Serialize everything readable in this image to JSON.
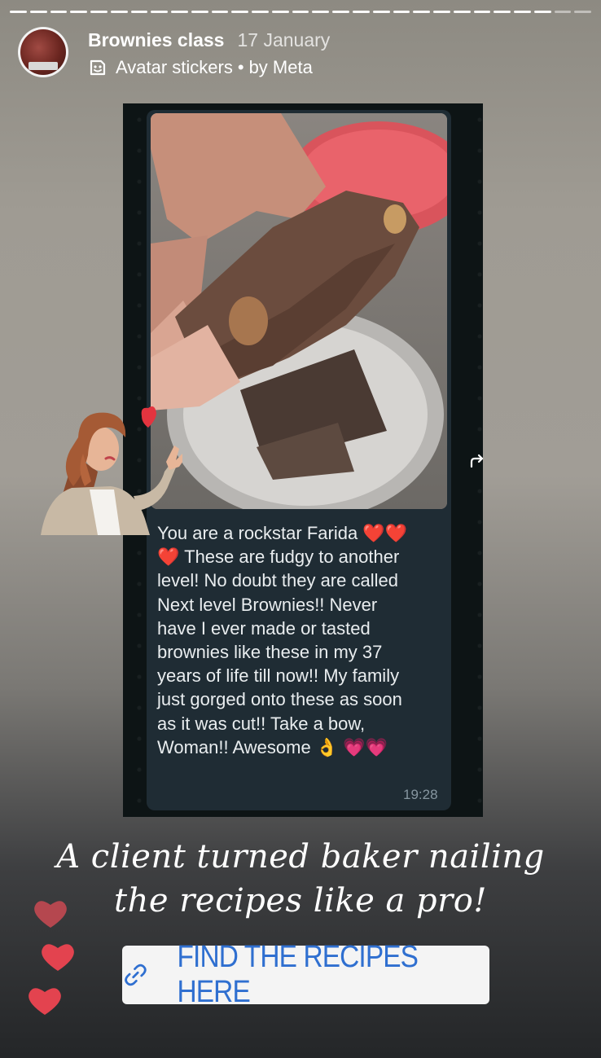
{
  "story": {
    "account_name": "Brownies class",
    "date": "17 January",
    "sub_label": "Avatar stickers",
    "separator": "•",
    "by_label": "by Meta"
  },
  "chat": {
    "message_lines": [
      "You are a rockstar Farida",
      "These are fudgy to another",
      "level! No doubt they are called",
      "Next level Brownies!! Never",
      "have I ever made or tasted",
      "brownies like these in my 37",
      "years of life till now!! My family",
      "just gorged onto these as soon",
      "as it was cut!! Take a bow,",
      "Woman!! Awesome"
    ],
    "emoji_hearts_red": "❤️❤️",
    "emoji_heart_red_single": "❤️",
    "emoji_ok": "👌",
    "emoji_hearts_pink": "💗💗",
    "time": "19:28"
  },
  "caption": {
    "line1": "A client turned baker nailing",
    "line2": "the recipes like a pro!"
  },
  "link_sticker": {
    "label": "FIND THE RECIPES HERE",
    "icon": "link-icon"
  },
  "colors": {
    "link_blue": "#2f6fd0",
    "heart_red": "#e3434f",
    "bubble_bg": "#1f2c34",
    "chat_text": "#e9edef",
    "time_text": "#8696a0"
  }
}
